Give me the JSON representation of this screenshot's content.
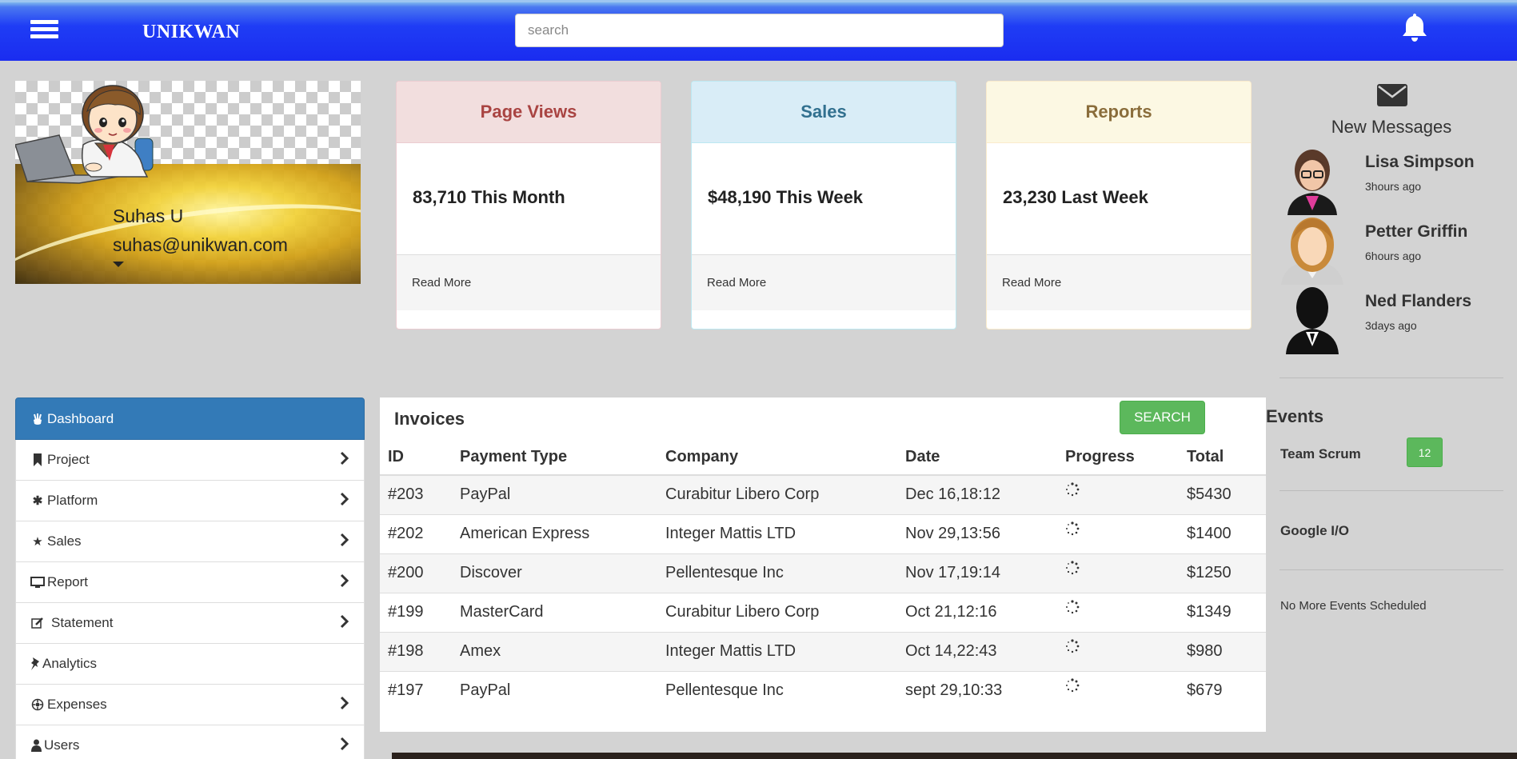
{
  "navbar": {
    "brand": "UNIKWAN",
    "search_placeholder": "search"
  },
  "profile": {
    "name": "Suhas U",
    "email": "suhas@unikwan.com"
  },
  "panels": [
    {
      "title": "Page Views",
      "value": "83,710 This Month",
      "link": "Read More"
    },
    {
      "title": "Sales",
      "value": "$48,190 This Week",
      "link": "Read More"
    },
    {
      "title": "Reports",
      "value": "23,230 Last Week",
      "link": "Read More"
    }
  ],
  "messages": {
    "title": "New Messages",
    "items": [
      {
        "name": "Lisa Simpson",
        "time": "3hours ago"
      },
      {
        "name": "Petter Griffin",
        "time": "6hours ago"
      },
      {
        "name": "Ned Flanders",
        "time": "3days ago"
      }
    ]
  },
  "sidebar": {
    "items": [
      {
        "label": "Dashboard",
        "icon": "dashboard-icon"
      },
      {
        "label": "Project",
        "icon": "bookmark-icon"
      },
      {
        "label": "Platform",
        "icon": "asterisk-icon"
      },
      {
        "label": "Sales",
        "icon": "star-icon"
      },
      {
        "label": "Report",
        "icon": "monitor-icon"
      },
      {
        "label": "Statement",
        "icon": "edit-icon"
      },
      {
        "label": "Analytics",
        "icon": "pushpin-icon"
      },
      {
        "label": "Expenses",
        "icon": "gear-icon"
      },
      {
        "label": "Users",
        "icon": "user-icon"
      }
    ]
  },
  "invoices": {
    "title": "Invoices",
    "search_label": "SEARCH",
    "columns": [
      "ID",
      "Payment Type",
      "Company",
      "Date",
      "Progress",
      "Total"
    ],
    "rows": [
      {
        "id": "#203",
        "payment": "PayPal",
        "company": "Curabitur Libero Corp",
        "date": "Dec 16,18:12",
        "total": "$5430"
      },
      {
        "id": "#202",
        "payment": "American Express",
        "company": "Integer Mattis LTD",
        "date": "Nov 29,13:56",
        "total": "$1400"
      },
      {
        "id": "#200",
        "payment": "Discover",
        "company": "Pellentesque Inc",
        "date": "Nov 17,19:14",
        "total": "$1250"
      },
      {
        "id": "#199",
        "payment": "MasterCard",
        "company": "Curabitur Libero Corp",
        "date": "Oct 21,12:16",
        "total": "$1349"
      },
      {
        "id": "#198",
        "payment": "Amex",
        "company": "Integer Mattis LTD",
        "date": "Oct 14,22:43",
        "total": "$980"
      },
      {
        "id": "#197",
        "payment": "PayPal",
        "company": "Pellentesque Inc",
        "date": "sept 29,10:33",
        "total": "$679"
      }
    ]
  },
  "events": {
    "title": "Events",
    "items": [
      {
        "name": "Team Scrum",
        "badge": "12"
      },
      {
        "name": "Google I/O"
      }
    ],
    "footer": "No More Events Scheduled"
  },
  "colors": {
    "navbar": "#1f3df5",
    "primary": "#337ab7",
    "success": "#5cb85c",
    "danger_bg": "#f2dede",
    "info_bg": "#d9edf7",
    "warning_bg": "#fcf8e3"
  }
}
